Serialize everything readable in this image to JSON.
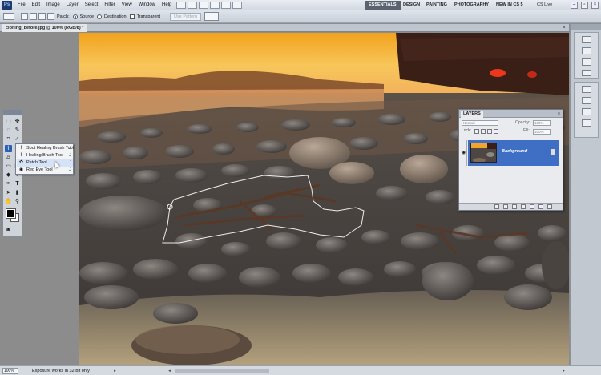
{
  "app": {
    "logo": "Ps"
  },
  "menu": [
    "File",
    "Edit",
    "Image",
    "Layer",
    "Select",
    "Filter",
    "View",
    "Window",
    "Help"
  ],
  "workspaces": [
    "ESSENTIALS",
    "DESIGN",
    "PAINTING",
    "PHOTOGRAPHY",
    "NEW IN CS 5"
  ],
  "active_workspace": "ESSENTIALS",
  "cs_live": "CS Live",
  "options": {
    "patch_label": "Patch:",
    "source": "Source",
    "destination": "Destination",
    "transparent": "Transparent",
    "use_pattern": "Use Pattern"
  },
  "document": {
    "tab": "cloning_before.jpg @ 100% (RGB/8) *"
  },
  "flyout": [
    {
      "icon": "spot-healing-brush-icon",
      "label": "Spot Healing Brush Tool",
      "key": "J"
    },
    {
      "icon": "healing-brush-icon",
      "label": "Healing Brush Tool",
      "key": "J"
    },
    {
      "icon": "patch-tool-icon",
      "label": "Patch Tool",
      "key": "J"
    },
    {
      "icon": "red-eye-icon",
      "label": "Red Eye Tool",
      "key": "J"
    }
  ],
  "layers": {
    "tab": "LAYERS",
    "blend_mode": "Normal",
    "opacity_label": "Opacity:",
    "opacity": "100%",
    "lock_label": "Lock:",
    "fill_label": "Fill:",
    "fill": "100%",
    "layer_name": "Background"
  },
  "status": {
    "zoom": "100%",
    "message": "Exposure works in 32-bit only"
  },
  "colors": {
    "selection_blue": "#3e6fc4",
    "active_workspace": "#5b6270",
    "foreground": "#000000",
    "background": "#ffffff"
  }
}
